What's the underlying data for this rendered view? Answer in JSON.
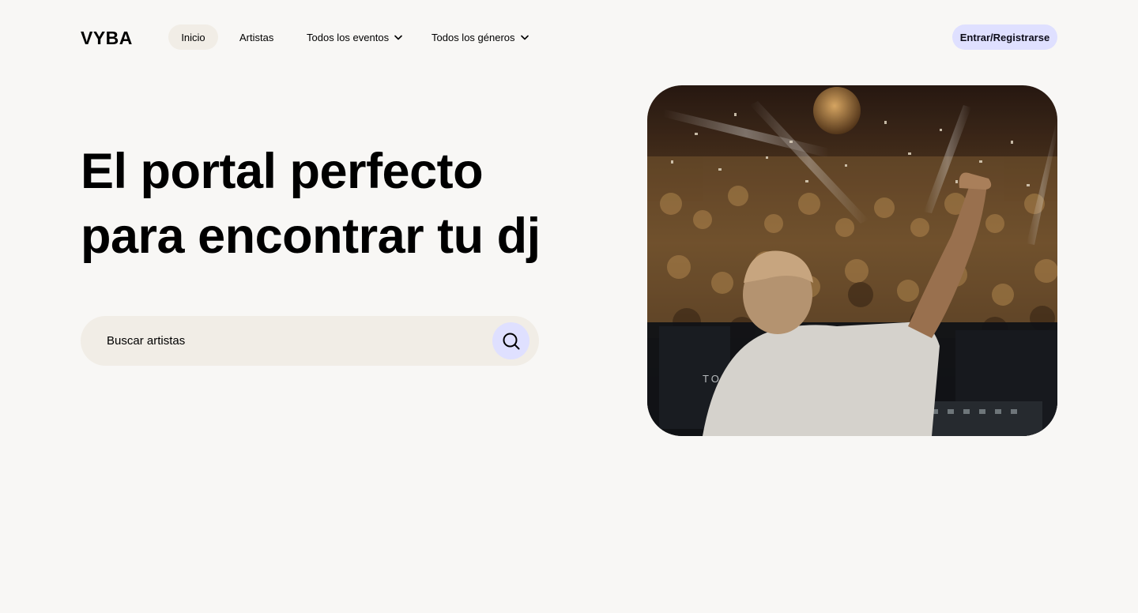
{
  "header": {
    "logo": "VYBA",
    "nav": {
      "inicio": "Inicio",
      "artistas": "Artistas",
      "eventos": "Todos los eventos",
      "generos": "Todos los géneros"
    },
    "login_label": "Entrar/Registrarse"
  },
  "hero": {
    "title_line1": "El portal perfecto",
    "title_line2": "para encontrar tu dj",
    "search": {
      "placeholder": "Buscar artistas"
    },
    "image_text": "TO"
  },
  "colors": {
    "background": "#f8f7f5",
    "accent": "#dfe0ff",
    "soft": "#f1ede6"
  },
  "icons": {
    "search": "search-icon",
    "chevron": "chevron-down-icon"
  }
}
